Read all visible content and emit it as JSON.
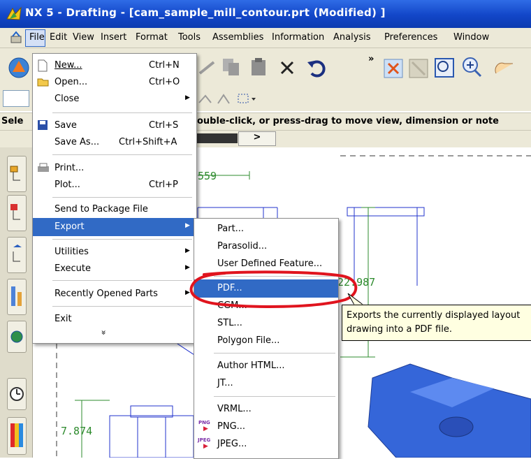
{
  "window": {
    "title": "NX 5 - Drafting - [cam_sample_mill_contour.prt (Modified) ]"
  },
  "menubar": {
    "items": [
      "File",
      "Edit",
      "View",
      "Insert",
      "Format",
      "Tools",
      "Assemblies",
      "Information",
      "Analysis",
      "Preferences",
      "Window"
    ]
  },
  "cue": {
    "left_fragment": "Sele",
    "text": "ouble-click, or press-drag to move view, dimension or note"
  },
  "toolbar": {
    "overflow": "»",
    "tab_arrow": ">"
  },
  "file_menu": {
    "items": [
      {
        "label": "New...",
        "shortcut": "Ctrl+N"
      },
      {
        "label": "Open...",
        "shortcut": "Ctrl+O"
      },
      {
        "label": "Close",
        "shortcut": ""
      },
      {
        "label": "Save",
        "shortcut": "Ctrl+S"
      },
      {
        "label": "Save As...",
        "shortcut": "Ctrl+Shift+A"
      },
      {
        "label": "Print...",
        "shortcut": ""
      },
      {
        "label": "Plot...",
        "shortcut": "Ctrl+P"
      },
      {
        "label": "Send to Package File",
        "shortcut": ""
      },
      {
        "label": "Export",
        "shortcut": ""
      },
      {
        "label": "Utilities",
        "shortcut": ""
      },
      {
        "label": "Execute",
        "shortcut": ""
      },
      {
        "label": "Recently Opened Parts",
        "shortcut": ""
      },
      {
        "label": "Exit",
        "shortcut": ""
      }
    ],
    "expand": "»"
  },
  "export_menu": {
    "items": [
      "Part...",
      "Parasolid...",
      "User Defined Feature...",
      "PDF...",
      "CGM...",
      "STL...",
      "Polygon File...",
      "Author HTML...",
      "JT...",
      "VRML...",
      "PNG...",
      "JPEG..."
    ],
    "png_badge": "PNG",
    "jpeg_badge": "JPEG"
  },
  "tooltip": {
    "line1": "Exports the currently displayed layout",
    "line2": "drawing into a PDF file."
  },
  "drawing": {
    "dims": [
      "559",
      "22.987",
      "7.874"
    ]
  },
  "colors": {
    "highlight": "#316ac5",
    "annotation_red": "#e0141e",
    "drawing_green": "#2e8b2e",
    "drawing_blue": "#2233cc"
  }
}
